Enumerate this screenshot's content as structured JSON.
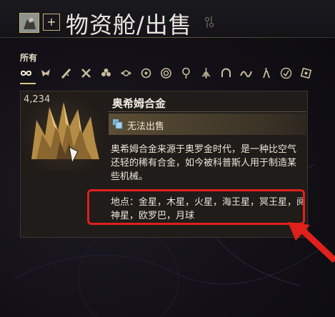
{
  "header": {
    "title": "物资舱/出售"
  },
  "filter": {
    "label": "所有",
    "tabs": [
      {
        "icon": "infinity-icon"
      },
      {
        "icon": "wing-icon"
      },
      {
        "icon": "sword-icon"
      },
      {
        "icon": "x-shape-icon"
      },
      {
        "icon": "flower-icon"
      },
      {
        "icon": "winged-circle-icon"
      },
      {
        "icon": "gear-flower-icon"
      },
      {
        "icon": "target-icon"
      },
      {
        "icon": "bulb-icon"
      },
      {
        "icon": "atom-icon"
      },
      {
        "icon": "horseshoe-icon"
      },
      {
        "icon": "wave-icon"
      },
      {
        "icon": "tool-icon"
      },
      {
        "icon": "badge-icon"
      },
      {
        "icon": "box-icon"
      }
    ]
  },
  "item": {
    "count": "4,234",
    "name": "奥希姆合金",
    "sell_status": "无法出售",
    "description": "奥希姆合金来源于奥罗金时代，是一种比空气还轻的稀有合金，如今被科普斯人用于制造某些机械。",
    "location": "地点：金星，木星，火星，海王星，冥王星，阋神星，欧罗巴，月球"
  },
  "colors": {
    "accent": "#e0c889",
    "annotation": "#e0201b",
    "panel": "#1f1c1a"
  }
}
